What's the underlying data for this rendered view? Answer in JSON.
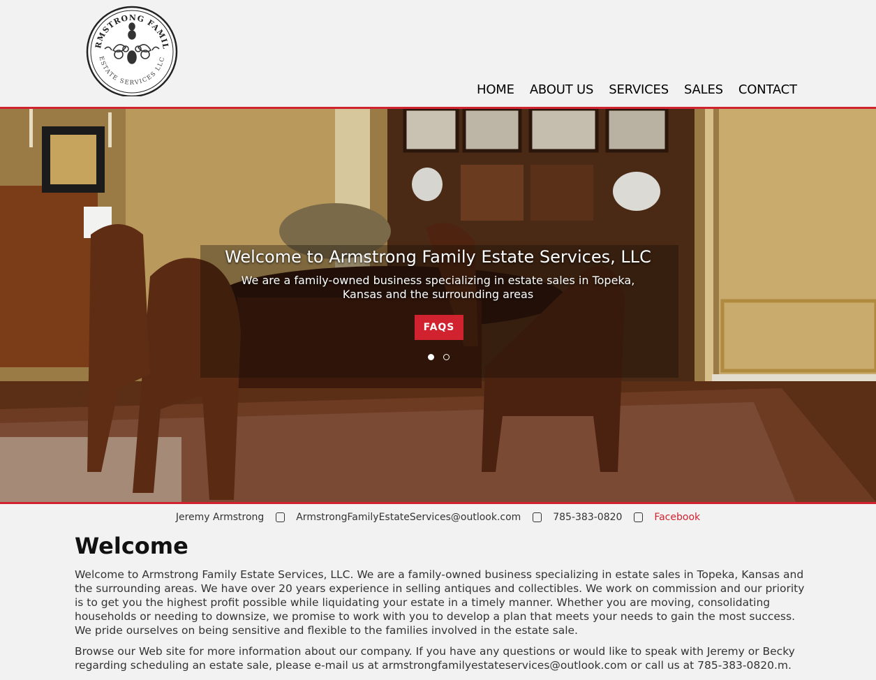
{
  "logo": {
    "text_top": "ARMSTRONG FAMILY",
    "text_bottom": "ESTATE SERVICES LLC"
  },
  "nav": {
    "items": [
      "HOME",
      "ABOUT US",
      "SERVICES",
      "SALES",
      "CONTACT"
    ]
  },
  "hero": {
    "title": "Welcome to Armstrong Family Estate Services, LLC",
    "subtitle": "We are a family-owned business specializing in estate sales in Topeka, Kansas and the surrounding areas",
    "button_label": "FAQS",
    "slide_count": 2,
    "active_slide": 1
  },
  "contact": {
    "name": "Jeremy Armstrong",
    "email": "ArmstrongFamilyEstateServices@outlook.com",
    "phone": "785-383-0820",
    "facebook": "Facebook"
  },
  "content": {
    "heading": "Welcome",
    "paragraph1": "Welcome to Armstrong Family Estate Services, LLC. We are a family-owned business specializing in estate sales in Topeka, Kansas and the surrounding areas. We have over 20 years experience in selling antiques and collectibles. We work on commission and our priority is to get you the highest profit possible while liquidating your estate in a timely manner. Whether you are moving, consolidating households or needing to downsize, we promise to work with you to develop a plan that meets your needs to gain the most success. We pride ourselves on being sensitive and flexible to the families involved in the estate sale.",
    "paragraph2": "Browse our Web site for more information about our company. If you have any questions or would like to speak with Jeremy or Becky regarding scheduling an estate sale, please e-mail us at armstrongfamilyestateservices@outlook.com or call us at 785-383-0820.m."
  },
  "colors": {
    "accent": "#d0222f",
    "background": "#f2f2f2"
  }
}
